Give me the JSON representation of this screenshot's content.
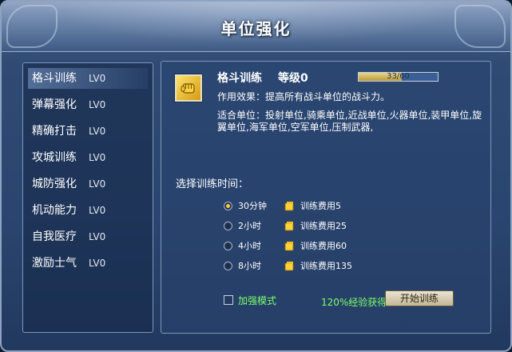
{
  "window": {
    "title": "单位强化"
  },
  "skills": [
    {
      "name": "格斗训练",
      "level": "LV0"
    },
    {
      "name": "弹幕强化",
      "level": "LV0"
    },
    {
      "name": "精确打击",
      "level": "LV0"
    },
    {
      "name": "攻城训练",
      "level": "LV0"
    },
    {
      "name": "城防强化",
      "level": "LV0"
    },
    {
      "name": "机动能力",
      "level": "LV0"
    },
    {
      "name": "自我医疗",
      "level": "LV0"
    },
    {
      "name": "激励士气",
      "level": "LV0"
    }
  ],
  "selected_index": 0,
  "detail": {
    "icon": "fist-icon",
    "name": "格斗训练",
    "level_label": "等级0",
    "xp_text": "33/60",
    "xp_current": 33,
    "xp_max": 60,
    "effect": "作用效果：提高所有战斗单位的战斗力。",
    "suitable": "适合单位：投射单位,骑乘单位,近战单位,火器单位,装甲单位,旋翼单位,海军单位,空军单位,压制武器,"
  },
  "training": {
    "label": "选择训练时间：",
    "options": [
      {
        "time": "30分钟",
        "cost": "训练费用5",
        "checked": true
      },
      {
        "time": "2小时",
        "cost": "训练费用25",
        "checked": false
      },
      {
        "time": "4小时",
        "cost": "训练费用60",
        "checked": false
      },
      {
        "time": "8小时",
        "cost": "训练费用135",
        "checked": false
      }
    ],
    "enhance_label": "加强模式",
    "exp_bonus": "120%经验获得",
    "start_button": "开始训练"
  },
  "colors": {
    "accent_green": "#7dff6a",
    "coin_gold": "#ffd23a"
  }
}
